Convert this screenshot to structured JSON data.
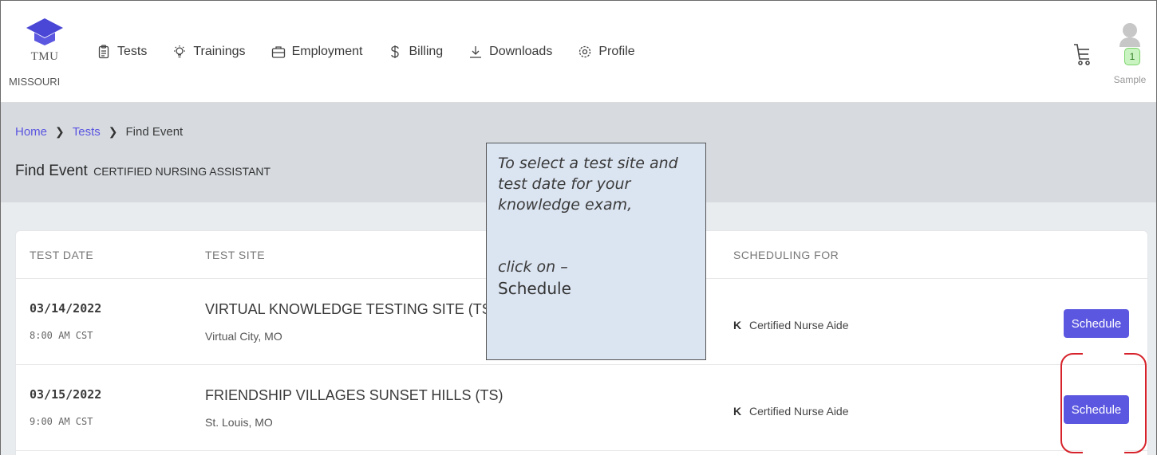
{
  "brand": {
    "name": "TMU",
    "state": "MISSOURI"
  },
  "nav": [
    {
      "label": "Tests",
      "icon": "clipboard-icon"
    },
    {
      "label": "Trainings",
      "icon": "lightbulb-icon"
    },
    {
      "label": "Employment",
      "icon": "briefcase-icon"
    },
    {
      "label": "Billing",
      "icon": "dollar-icon"
    },
    {
      "label": "Downloads",
      "icon": "download-icon"
    },
    {
      "label": "Profile",
      "icon": "gear-icon"
    }
  ],
  "user": {
    "name": "Sample",
    "badge": "1"
  },
  "breadcrumb": {
    "home": "Home",
    "tests": "Tests",
    "current": "Find Event"
  },
  "page": {
    "title": "Find Event",
    "subtitle": "CERTIFIED NURSING ASSISTANT"
  },
  "table": {
    "headers": {
      "date": "TEST DATE",
      "site": "TEST SITE",
      "scheduling": "SCHEDULING FOR"
    },
    "rows": [
      {
        "date": "03/14/2022",
        "time": "8:00 AM CST",
        "site": "VIRTUAL KNOWLEDGE TESTING SITE (TS)",
        "city": "Virtual City, MO",
        "code": "K",
        "scheduling": "Certified Nurse Aide",
        "button": "Schedule"
      },
      {
        "date": "03/15/2022",
        "time": "9:00 AM CST",
        "site": "FRIENDSHIP VILLAGES SUNSET HILLS (TS)",
        "city": "St. Louis, MO",
        "code": "K",
        "scheduling": "Certified Nurse Aide",
        "button": "Schedule"
      }
    ]
  },
  "callout": {
    "text": "To select a test site and test date for your knowledge exam,",
    "instruction": "click on –",
    "keyword": "Schedule"
  },
  "colors": {
    "accent": "#5b57e0",
    "highlight": "#d6222a",
    "band": "#d7dbe0",
    "callout_bg": "#dbe4f1"
  }
}
